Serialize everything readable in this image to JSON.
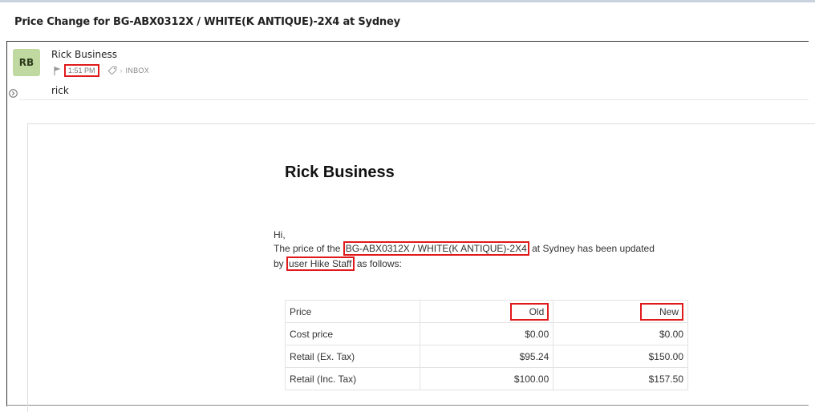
{
  "subject": "Price Change for BG-ABX0312X / WHITE(K ANTIQUE)-2X4 at Sydney",
  "message": {
    "avatar_initials": "RB",
    "sender_name": "Rick Business",
    "time": "1:51 PM",
    "folder": "INBOX",
    "recipient": "rick"
  },
  "email_body": {
    "business_name": "Rick Business",
    "greeting": "Hi,",
    "line1_prefix": "The price of the ",
    "product": "BG-ABX0312X / WHITE(K ANTIQUE)-2X4",
    "line1_suffix": " at Sydney has been updated",
    "line2_prefix": "by ",
    "user": "user Hike Staff",
    "line2_suffix": " as follows:",
    "table": {
      "headers": [
        "Price",
        "Old",
        "New"
      ],
      "rows": [
        [
          "Cost price",
          "$0.00",
          "$0.00"
        ],
        [
          "Retail (Ex. Tax)",
          "$95.24",
          "$150.00"
        ],
        [
          "Retail (Inc. Tax)",
          "$100.00",
          "$157.50"
        ]
      ]
    }
  },
  "colors": {
    "avatar_bg": "#bfd9a0",
    "highlight": "#e0191b"
  },
  "icons": [
    "flag-icon",
    "tag-icon",
    "expand-icon"
  ]
}
